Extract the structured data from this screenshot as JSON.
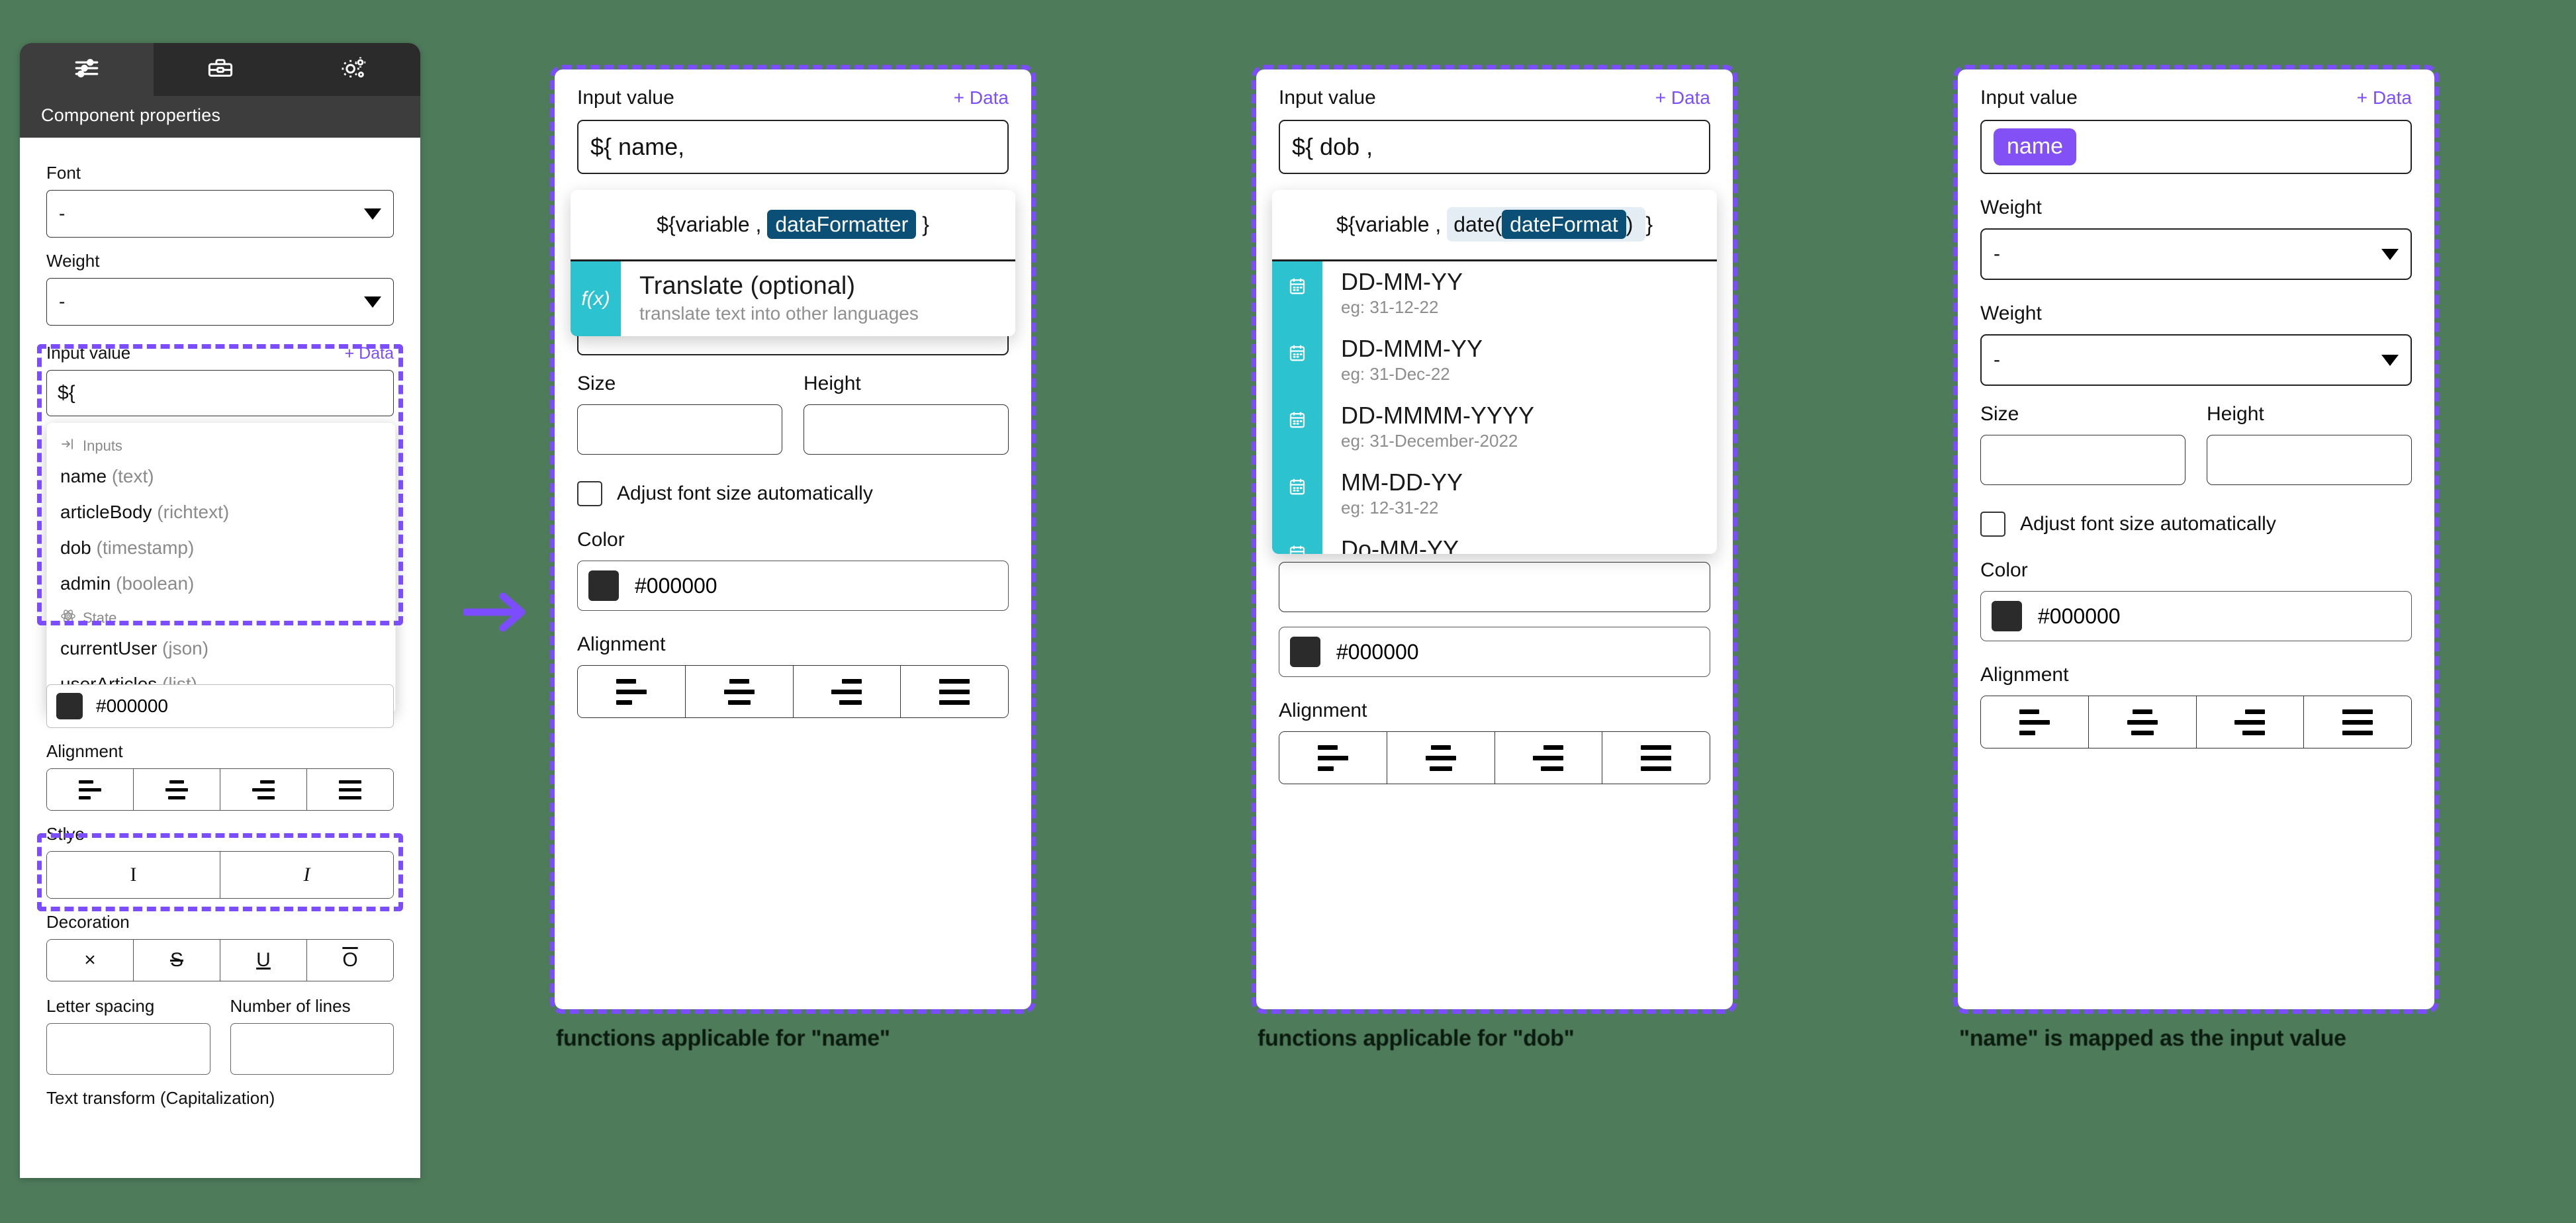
{
  "panel": {
    "tabs": [
      {
        "id": "properties",
        "icon": "sliders-icon",
        "active": true
      },
      {
        "id": "toolbox",
        "icon": "toolbox-icon",
        "active": false
      },
      {
        "id": "settings",
        "icon": "gears-icon",
        "active": false
      }
    ],
    "title": "Component properties",
    "font_label": "Font",
    "font_value": "-",
    "weight_label": "Weight",
    "weight_value": "-",
    "input_value_label": "Input value",
    "add_data_label": "+ Data",
    "input_value_text": "${",
    "autocomplete": {
      "groups": [
        {
          "name": "Inputs",
          "icon": "input-arrow-icon",
          "items": [
            {
              "name": "name",
              "type": "(text)"
            },
            {
              "name": "articleBody",
              "type": "(richtext)"
            },
            {
              "name": "dob",
              "type": "(timestamp)"
            },
            {
              "name": "admin",
              "type": "(boolean)"
            }
          ]
        },
        {
          "name": "State",
          "icon": "atom-icon",
          "items": [
            {
              "name": "currentUser",
              "type": "(json)"
            },
            {
              "name": "userArticles",
              "type": "(list)"
            }
          ]
        }
      ]
    },
    "color_value": "#000000",
    "color_swatch": "#2b2b2b",
    "alignment_label": "Alignment",
    "alignment_options": [
      "align-left",
      "align-center",
      "align-right",
      "align-justify"
    ],
    "style_label": "Stlye",
    "style_options": [
      "I",
      "I"
    ],
    "decoration_label": "Decoration",
    "decoration_options": [
      "×",
      "S",
      "U",
      "O"
    ],
    "letter_spacing_label": "Letter spacing",
    "number_of_lines_label": "Number of lines",
    "text_transform_label": "Text transform (Capitalization)"
  },
  "card1": {
    "input_value_label": "Input value",
    "add_data_label": "+ Data",
    "input_value_text": "${ name,",
    "popup": {
      "signature": {
        "prefix": "${variable ,",
        "token": "dataFormatter",
        "suffix": "}"
      },
      "items": [
        {
          "icon": "fx-icon",
          "title": "Translate (optional)",
          "desc": "translate text into other languages"
        }
      ]
    },
    "select_value": "-",
    "size_label": "Size",
    "height_label": "Height",
    "autosize_label": "Adjust font size automatically",
    "color_label": "Color",
    "color_value": "#000000",
    "color_swatch": "#2b2b2b",
    "alignment_label": "Alignment",
    "caption": "functions applicable for \"name\""
  },
  "card2": {
    "input_value_label": "Input value",
    "add_data_label": "+ Data",
    "input_value_text": "${ dob ,",
    "popup": {
      "signature": {
        "prefix": "${variable ,",
        "fn": "date",
        "open": "(",
        "token": "dateFormat",
        "close": ")",
        "suffix": "}"
      },
      "items": [
        {
          "icon": "calendar-icon",
          "title": "DD-MM-YY",
          "eg": "eg: 31-12-22"
        },
        {
          "icon": "calendar-icon",
          "title": "DD-MMM-YY",
          "eg": "eg: 31-Dec-22"
        },
        {
          "icon": "calendar-icon",
          "title": "DD-MMMM-YYYY",
          "eg": "eg: 31-December-2022"
        },
        {
          "icon": "calendar-icon",
          "title": "MM-DD-YY",
          "eg": "eg: 12-31-22"
        },
        {
          "icon": "calendar-icon",
          "title": "Do-MM-YY",
          "eg": ""
        }
      ]
    },
    "color_value": "#000000",
    "color_swatch": "#2b2b2b",
    "alignment_label": "Alignment",
    "caption": "functions applicable for \"dob\""
  },
  "card3": {
    "input_value_label": "Input value",
    "add_data_label": "+ Data",
    "chip_label": "name",
    "chip_color": "#8250f5",
    "weight_label_1": "Weight",
    "weight_value_1": "-",
    "weight_label_2": "Weight",
    "weight_value_2": "-",
    "size_label": "Size",
    "height_label": "Height",
    "autosize_label": "Adjust font size automatically",
    "color_label": "Color",
    "color_value": "#000000",
    "color_swatch": "#2b2b2b",
    "alignment_label": "Alignment",
    "caption": "\"name\" is mapped as the input value"
  },
  "accent": {
    "purple": "#7c4dff",
    "teal": "#2cc2d0",
    "dark_token": "#0b4f76",
    "background": "#4e7c5b"
  }
}
